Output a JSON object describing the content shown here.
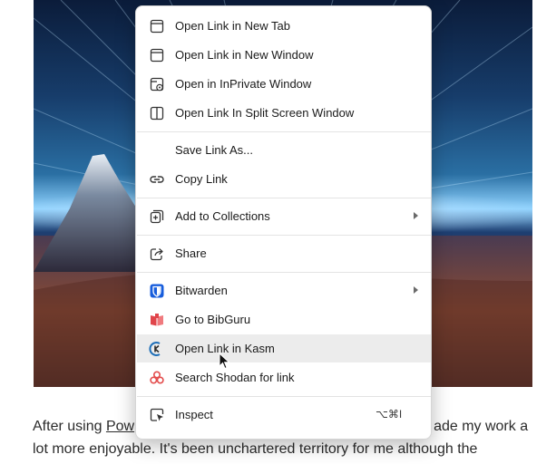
{
  "context_menu": {
    "items": [
      {
        "label": "Open Link in New Tab",
        "icon": "new-tab-icon"
      },
      {
        "label": "Open Link in New Window",
        "icon": "new-window-icon"
      },
      {
        "label": "Open in InPrivate Window",
        "icon": "inprivate-window-icon"
      },
      {
        "label": "Open Link In Split Screen Window",
        "icon": "split-screen-icon"
      },
      {
        "label": "Save Link As..."
      },
      {
        "label": "Copy Link",
        "icon": "link-icon"
      },
      {
        "label": "Add to Collections",
        "icon": "collections-icon",
        "submenu": true
      },
      {
        "label": "Share",
        "icon": "share-icon"
      },
      {
        "label": "Bitwarden",
        "icon": "bitwarden-icon",
        "submenu": true
      },
      {
        "label": "Go to BibGuru",
        "icon": "bibguru-icon"
      },
      {
        "label": "Open Link in Kasm",
        "icon": "kasm-icon",
        "hovered": true
      },
      {
        "label": "Search Shodan for link",
        "icon": "shodan-icon"
      },
      {
        "label": "Inspect",
        "icon": "inspect-icon",
        "shortcut": "⌥⌘I"
      }
    ]
  },
  "article": {
    "line1_start": "After using ",
    "line1_link": "Pow",
    "line1_end": "ade my work a",
    "line2": "lot more enjoyable. It's been unchartered territory for me although the"
  },
  "colors": {
    "bitwarden": "#175DDC",
    "bibguru": "#E0454B",
    "kasm": "#1F6FB8",
    "shodan": "#E34C4C"
  }
}
